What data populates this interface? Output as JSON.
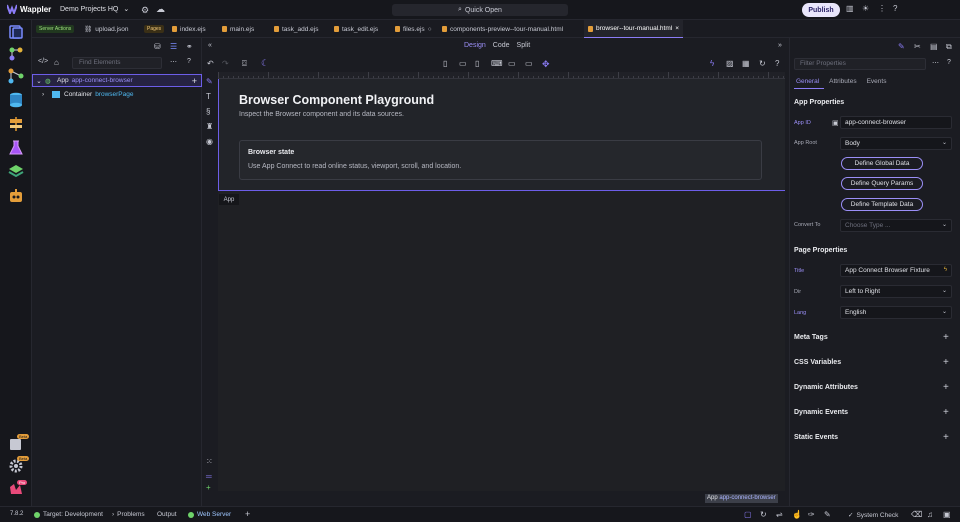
{
  "app": {
    "name": "Wappler",
    "project": "Demo Projects HQ"
  },
  "topbar": {
    "quick_open": "Quick Open",
    "publish": "Publish"
  },
  "tabs": [
    {
      "label": "Server Actions",
      "kind": "chip"
    },
    {
      "label": "upload.json"
    },
    {
      "label": "Pages",
      "kind": "chip"
    },
    {
      "label": "index.ejs"
    },
    {
      "label": "main.ejs"
    },
    {
      "label": "task_add.ejs"
    },
    {
      "label": "task_edit.ejs"
    },
    {
      "label": "files.ejs"
    },
    {
      "label": "components-preview--tour-manual.html"
    },
    {
      "label": "browser--tour-manual.html",
      "active": true
    }
  ],
  "structure": {
    "find_placeholder": "Find Elements",
    "tree": [
      {
        "type": "App",
        "name": "app-connect-browser"
      },
      {
        "type": "Container",
        "name": "browserPage"
      }
    ]
  },
  "views": [
    "Design",
    "Code",
    "Split"
  ],
  "canvas": {
    "heading": "Browser Component Playground",
    "lead": "Inspect the Browser component and its data sources.",
    "card_title": "Browser state",
    "card_text": "Use App Connect to read online status, viewport, scroll, and location.",
    "app_tag": "App",
    "breadcrumb_type": "App",
    "breadcrumb_name": "app-connect-browser"
  },
  "properties": {
    "filter_placeholder": "Filter Properties",
    "tabs": [
      "General",
      "Attributes",
      "Events"
    ],
    "app_section": "App Properties",
    "app_id_label": "App ID",
    "app_id": "app-connect-browser",
    "app_root_label": "App Root",
    "app_root": "Body",
    "buttons": [
      "Define Global Data",
      "Define Query Params",
      "Define Template Data"
    ],
    "convert_label": "Convert To",
    "convert_placeholder": "Choose Type ...",
    "page_section": "Page Properties",
    "title_label": "Title",
    "title": "App Connect Browser Fixture",
    "dir_label": "Dir",
    "dir": "Left to Right",
    "lang_label": "Lang",
    "lang": "English",
    "collapsed": [
      "Meta Tags",
      "CSS Variables",
      "Dynamic Attributes",
      "Dynamic Events",
      "Static Events"
    ]
  },
  "rail_badges": [
    "Beta",
    "Beta",
    "Pro"
  ],
  "statusbar": {
    "version": "7.8.2",
    "target": "Target: Development",
    "problems": "Problems",
    "output": "Output",
    "web_server": "Web Server",
    "system_check": "System Check"
  },
  "colors": {
    "accent": "#8b7cf6",
    "green": "#6fd36a",
    "orange": "#e39d3a"
  }
}
